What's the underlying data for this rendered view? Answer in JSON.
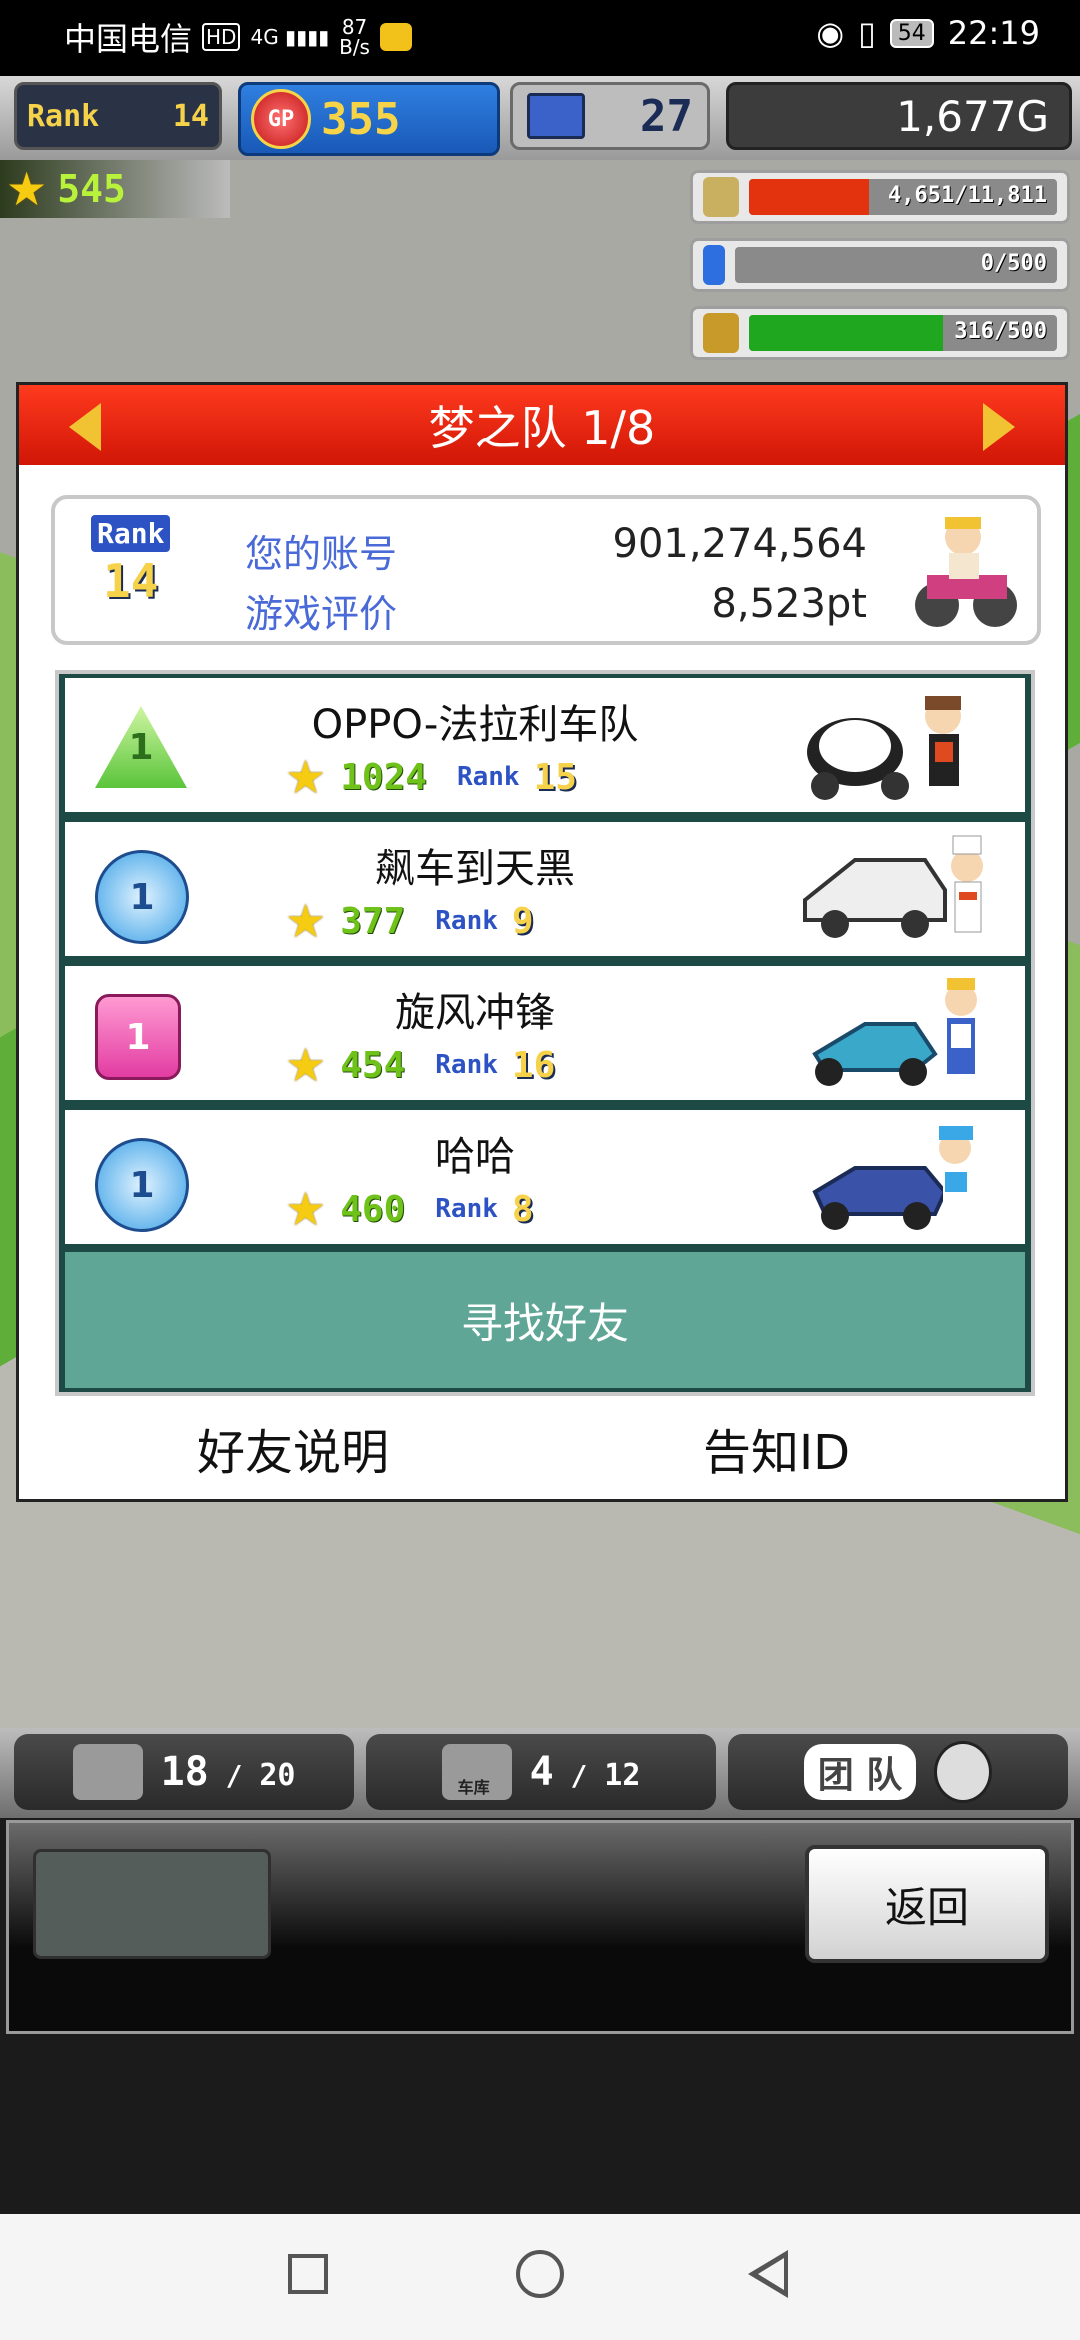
{
  "status_bar": {
    "carrier": "中国电信",
    "hd": "HD",
    "signal": "4G",
    "speed_value": "87",
    "speed_unit": "B/s",
    "battery": "54",
    "time": "22:19"
  },
  "hud": {
    "rank_label": "Rank",
    "rank_value": "14",
    "gp_label": "GP",
    "gp_value": "355",
    "pc_value": "27",
    "money": "1,677G"
  },
  "stars": {
    "value": "545"
  },
  "resources": [
    {
      "icon": "coin-stack-icon",
      "text": "4,651/11,811",
      "fill": 0.39,
      "color": "#e3320e"
    },
    {
      "icon": "fuel-bottle-icon",
      "text": "0/500",
      "fill": 0.0,
      "color": "#2d6fe0"
    },
    {
      "icon": "wheat-icon",
      "text": "316/500",
      "fill": 0.63,
      "color": "#1fa81f"
    }
  ],
  "dialog": {
    "title": "梦之队 1/8",
    "account": {
      "rank_label": "Rank",
      "rank_value": "14",
      "id_label": "您的账号",
      "id_value": "901,274,564",
      "rating_label": "游戏评价",
      "rating_value": "8,523pt"
    },
    "friends": [
      {
        "badge_shape": "tri",
        "badge_num": "1",
        "name": "OPPO-法拉利车队",
        "stars": "1024",
        "rank_label": "Rank",
        "rank": "15"
      },
      {
        "badge_shape": "circle",
        "badge_num": "1",
        "name": "飙车到天黑",
        "stars": "377",
        "rank_label": "Rank",
        "rank": "9"
      },
      {
        "badge_shape": "square",
        "badge_num": "1",
        "name": "旋风冲锋",
        "stars": "454",
        "rank_label": "Rank",
        "rank": "16"
      },
      {
        "badge_shape": "circle",
        "badge_num": "1",
        "name": "哈哈",
        "stars": "460",
        "rank_label": "Rank",
        "rank": "8"
      }
    ],
    "find_friend": "寻找好友",
    "friend_help": "好友说明",
    "notify_id": "告知ID"
  },
  "bottom_tabs": {
    "garage_count": "18",
    "garage_max": "20",
    "car_count": "4",
    "car_max": "12",
    "car_caption": "车库",
    "team_label": "团 队"
  },
  "panel": {
    "back": "返回"
  }
}
